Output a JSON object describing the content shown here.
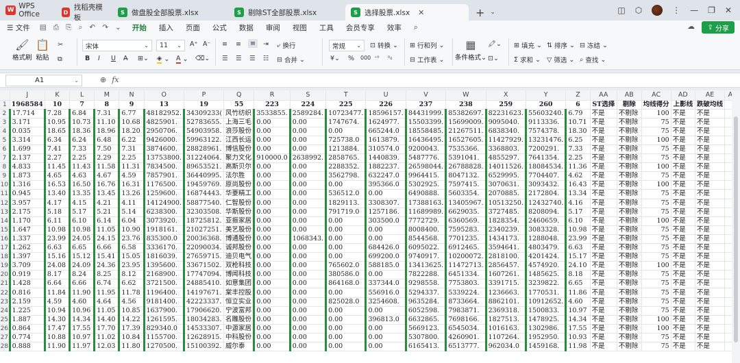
{
  "app": {
    "name": "WPS Office"
  },
  "tabs": [
    {
      "label": "找稻壳模板",
      "icon": "wps-doc-icon",
      "color": "#e0342c"
    },
    {
      "label": "做盘股全部股票.xlsx",
      "icon": "sheet-icon",
      "color": "#1f9e4a"
    },
    {
      "label": "剔除ST全部股票.xlsx",
      "icon": "sheet-icon",
      "color": "#1f9e4a"
    },
    {
      "label": "选择股票.xlsx",
      "icon": "sheet-icon",
      "color": "#1f9e4a",
      "active": true
    }
  ],
  "menu": [
    "文件",
    "开始",
    "插入",
    "页面",
    "公式",
    "数据",
    "审阅",
    "视图",
    "工具",
    "会员专享",
    "效率"
  ],
  "share_label": "分享",
  "ribbon": {
    "format_painter": "格式刷",
    "paste": "粘贴",
    "font_name": "宋体",
    "font_size": "11",
    "wrap": "换行",
    "merge": "合并",
    "number_format": "常规",
    "convert": "转换",
    "row_col": "行和列",
    "worksheet": "工作表",
    "cond_format": "条件格式",
    "fill": "填充",
    "sort": "排序",
    "freeze": "冻结",
    "sum": "求和",
    "filter": "筛选",
    "find": "查找"
  },
  "formula_bar": {
    "cell_ref": "A1",
    "fx": "fx",
    "content": ""
  },
  "columns": [
    "J",
    "K",
    "L",
    "M",
    "N",
    "O",
    "P",
    "Q",
    "R",
    "S",
    "T",
    "U",
    "V",
    "W",
    "X",
    "Y",
    "Z",
    "AA",
    "AB",
    "AC",
    "AD",
    "AE",
    "AF"
  ],
  "header_row": [
    "1968584",
    "10",
    "7",
    "8",
    "9",
    "13",
    "19",
    "55",
    "223",
    "224",
    "225",
    "226",
    "237",
    "238",
    "259",
    "260",
    "6",
    "ST选择",
    "剔除",
    "均线得分",
    "上影线",
    "跌破均线",
    ""
  ],
  "rows": [
    [
      "2",
      "17.714",
      "7.28",
      "6.84",
      "7.31",
      "6.77",
      "48182952.",
      "34309233(",
      "风竹纺织",
      "3533855.",
      "2589284.",
      "10723477.",
      "18596157.",
      "84431999.",
      "85382697.",
      "82231623.",
      "55603240.",
      "6.79",
      "不是",
      "不剔除",
      "100",
      "不是",
      "不是"
    ],
    [
      "3",
      "3.171",
      "10.95",
      "10.73",
      "11.10",
      "10.68",
      "4825901.",
      "52783655.",
      "上海三毛",
      "0.00",
      "0.00",
      "1747674.",
      "1624977.",
      "15503399.",
      "15699009.",
      "9095040.",
      "9113336.",
      "10.71",
      "不是",
      "不剔除",
      "75",
      "不是",
      "不是"
    ],
    [
      "4",
      "0.035",
      "18.65",
      "18.36",
      "18.96",
      "18.20",
      "2950706.",
      "54903958.",
      "浪莎股份",
      "0.00",
      "0.00",
      "0.00",
      "665244.0",
      "18558485.",
      "21267511.",
      "6838340.",
      "7574378.",
      "18.30",
      "不是",
      "不剔除",
      "75",
      "不是",
      "不是"
    ],
    [
      "5",
      "3.314",
      "6.34",
      "6.24",
      "6.48",
      "6.22",
      "9426000.",
      "59963122.",
      "江西长运",
      "0.00",
      "0.00",
      "725738.0",
      "1613879.",
      "16436495.",
      "16527605.",
      "11427929.",
      "13231476.",
      "6.25",
      "不是",
      "不剔除",
      "100",
      "不是",
      "不是"
    ],
    [
      "6",
      "1.699",
      "7.41",
      "7.33",
      "7.50",
      "7.31",
      "3874600.",
      "28828961.",
      "博信股份",
      "0.00",
      "0.00",
      "1213884.",
      "310574.0",
      "9200043.",
      "7535366.",
      "3368803.",
      "7200291.",
      "7.33",
      "不是",
      "不剔除",
      "75",
      "不是",
      "不是"
    ],
    [
      "7",
      "2.137",
      "2.27",
      "2.25",
      "2.29",
      "2.25",
      "13753800.",
      "31224064.",
      "聚力文化",
      "910000.0",
      "2638992.",
      "2858765.",
      "1440839.",
      "5487776.",
      "5391041.",
      "4855297.",
      "7641354.",
      "2.25",
      "不是",
      "不剔除",
      "75",
      "不是",
      "不是"
    ],
    [
      "8",
      "4.833",
      "11.45",
      "11.43",
      "11.58",
      "11.31",
      "7834500.",
      "89653521.",
      "高斯贝尔",
      "0.00",
      "0.00",
      "2288352.",
      "1882237.",
      "26598044.",
      "26788828.",
      "14011526.",
      "18084534.",
      "11.36",
      "不是",
      "不剔除",
      "100",
      "不是",
      "不是"
    ],
    [
      "9",
      "1.873",
      "4.65",
      "4.63",
      "4.67",
      "4.59",
      "7857901.",
      "36440995.",
      "法尔胜",
      "0.00",
      "0.00",
      "3562798.",
      "632247.0",
      "9964415.",
      "8047132.",
      "6529995.",
      "7704407.",
      "4.62",
      "不是",
      "不剔除",
      "75",
      "不是",
      "不是"
    ],
    [
      "10",
      "1.316",
      "16.53",
      "16.50",
      "16.76",
      "16.31",
      "1176500.",
      "19459769.",
      "原尚股份",
      "0.00",
      "0.00",
      "0.00",
      "395366.0",
      "5302925.",
      "7597415.",
      "3070631.",
      "3093432.",
      "16.43",
      "不是",
      "不剔除",
      "100",
      "不是",
      "不是"
    ],
    [
      "11",
      "0.945",
      "13.40",
      "13.35",
      "13.45",
      "13.26",
      "1259600.",
      "16874443.",
      "华菱精工",
      "0.00",
      "0.00",
      "536512.0",
      "0.00",
      "6490888.",
      "5603354.",
      "2070885.",
      "2172804.",
      "13.34",
      "不是",
      "不剔除",
      "75",
      "不是",
      "不是"
    ],
    [
      "12",
      "3.957",
      "4.17",
      "4.15",
      "4.21",
      "4.11",
      "14124900.",
      "58877540.",
      "仁智股份",
      "0.00",
      "0.00",
      "1829113.",
      "3308307.",
      "17388163.",
      "13405967.",
      "10513250.",
      "12432740.",
      "4.16",
      "不是",
      "不剔除",
      "75",
      "不是",
      "不是"
    ],
    [
      "13",
      "2.175",
      "5.18",
      "5.17",
      "5.21",
      "5.14",
      "6238300.",
      "32303508.",
      "华斯股份",
      "0.00",
      "0.00",
      "791719.0",
      "1257186.",
      "11689989.",
      "6629035.",
      "3727485.",
      "8208094.",
      "5.17",
      "不是",
      "不剔除",
      "75",
      "不是",
      "不是"
    ],
    [
      "14",
      "1.170",
      "6.11",
      "6.10",
      "6.14",
      "6.04",
      "3073920.",
      "18725812.",
      "亚振家居",
      "0.00",
      "0.00",
      "0.00",
      "303500.0",
      "7772729.",
      "6360569.",
      "1828354.",
      "2460659.",
      "6.10",
      "不是",
      "不剔除",
      "100",
      "不是",
      "不是"
    ],
    [
      "15",
      "1.647",
      "10.98",
      "10.98",
      "11.05",
      "10.90",
      "1918161.",
      "21027251.",
      "美艺股份",
      "0.00",
      "0.00",
      "0.00",
      "0.00",
      "8008400.",
      "7595283.",
      "2340239.",
      "3083328.",
      "10.98",
      "不是",
      "不剔除",
      "75",
      "不是",
      "不是"
    ],
    [
      "16",
      "1.337",
      "23.99",
      "24.05",
      "24.15",
      "23.76",
      "835300.0",
      "20036368.",
      "博通股份",
      "0.00",
      "1068343.",
      "0.00",
      "0.00",
      "8544568.",
      "7701235.",
      "1434173.",
      "1288048.",
      "23.99",
      "不是",
      "不剔除",
      "75",
      "不是",
      "不是"
    ],
    [
      "17",
      "1.262",
      "6.63",
      "6.65",
      "6.66",
      "6.58",
      "3336170.",
      "22090034.",
      "诚邦股份",
      "0.00",
      "0.00",
      "0.00",
      "684426.0",
      "6095022.",
      "6912465.",
      "3594641.",
      "4803479.",
      "6.63",
      "不是",
      "不剔除",
      "75",
      "不是",
      "不是"
    ],
    [
      "18",
      "1.397",
      "15.16",
      "15.12",
      "15.41",
      "15.05",
      "1816039.",
      "27659715.",
      "迪贝电气",
      "0.00",
      "0.00",
      "0.00",
      "699200.0",
      "9740917.",
      "10200072.",
      "2818100.",
      "4201424.",
      "15.17",
      "不是",
      "不剔除",
      "75",
      "不是",
      "不是"
    ],
    [
      "19",
      "3.709",
      "24.08",
      "24.09",
      "24.36",
      "23.95",
      "1395600.",
      "33671502.",
      "双枪科技",
      "0.00",
      "0.00",
      "765602.0",
      "588185.0",
      "13413625.",
      "11472713.",
      "2856457.",
      "4574920.",
      "24.10",
      "不是",
      "不剔除",
      "100",
      "不是",
      "不是"
    ],
    [
      "20",
      "0.919",
      "8.17",
      "8.24",
      "8.25",
      "8.12",
      "2168900.",
      "17747094.",
      "博闻科技",
      "0.00",
      "0.00",
      "380586.0",
      "0.00",
      "7822288.",
      "6451334.",
      "1607261.",
      "1485625.",
      "8.18",
      "不是",
      "不剔除",
      "75",
      "不是",
      "不是"
    ],
    [
      "21",
      "1.428",
      "6.64",
      "6.66",
      "6.74",
      "6.62",
      "3721500.",
      "24885410.",
      "如意集团",
      "0.00",
      "0.00",
      "864168.0",
      "337344.0",
      "9298558.",
      "7753803.",
      "3391715.",
      "3239822.",
      "6.65",
      "不是",
      "不剔除",
      "75",
      "不是",
      "不是"
    ],
    [
      "22",
      "0.816",
      "11.84",
      "11.90",
      "11.95",
      "11.78",
      "1196400.",
      "14197671.",
      "棠丰控股",
      "0.00",
      "0.00",
      "0.00",
      "556916.0",
      "5294337.",
      "5339224.",
      "1236663.",
      "1770531.",
      "11.86",
      "不是",
      "不剔除",
      "75",
      "不是",
      "不是"
    ],
    [
      "23",
      "2.159",
      "4.59",
      "4.60",
      "4.64",
      "4.56",
      "9181400.",
      "42223337.",
      "恒立实业",
      "0.00",
      "0.00",
      "825028.0",
      "3254608.",
      "9635284.",
      "8733664.",
      "8862101.",
      "10912652.",
      "4.60",
      "不是",
      "不剔除",
      "75",
      "不是",
      "不是"
    ],
    [
      "24",
      "1.225",
      "10.94",
      "10.96",
      "11.05",
      "10.85",
      "1637900.",
      "17906620.",
      "宁波富邦",
      "0.00",
      "0.00",
      "0.00",
      "0.00",
      "6052598.",
      "7983871.",
      "2369318.",
      "1500833.",
      "10.97",
      "不是",
      "不剔除",
      "75",
      "不是",
      "不是"
    ],
    [
      "25",
      "1.887",
      "14.30",
      "14.34",
      "14.40",
      "14.22",
      "1261595.",
      "18034283.",
      "名雕股份",
      "0.00",
      "0.00",
      "0.00",
      "396813.0",
      "6632865.",
      "7698166.",
      "1827513.",
      "1478925.",
      "14.34",
      "不是",
      "不剔除",
      "100",
      "不是",
      "不是"
    ],
    [
      "26",
      "0.864",
      "17.47",
      "17.55",
      "17.70",
      "17.39",
      "829340.0",
      "14533307.",
      "中源家居",
      "0.00",
      "0.00",
      "0.00",
      "0.00",
      "5669123.",
      "6545034.",
      "1016163.",
      "1302986.",
      "17.55",
      "不是",
      "不剔除",
      "100",
      "不是",
      "不是"
    ],
    [
      "27",
      "0.774",
      "10.88",
      "10.97",
      "11.02",
      "10.84",
      "1155700.",
      "12628915.",
      "中科股份",
      "0.00",
      "0.00",
      "0.00",
      "0.00",
      "5307800.",
      "4260901.",
      "1107264.",
      "1952950.",
      "10.93",
      "不是",
      "不剔除",
      "75",
      "不是",
      "不是"
    ],
    [
      "28",
      "0.888",
      "11.90",
      "11.97",
      "12.03",
      "11.80",
      "1270500.",
      "15100392.",
      "威尔泰",
      "0.00",
      "0.00",
      "0.00",
      "0.00",
      "6165413.",
      "6513777.",
      "962034.0",
      "1459168.",
      "11.98",
      "不是",
      "不剔除",
      "75",
      "不是",
      "不是"
    ]
  ]
}
